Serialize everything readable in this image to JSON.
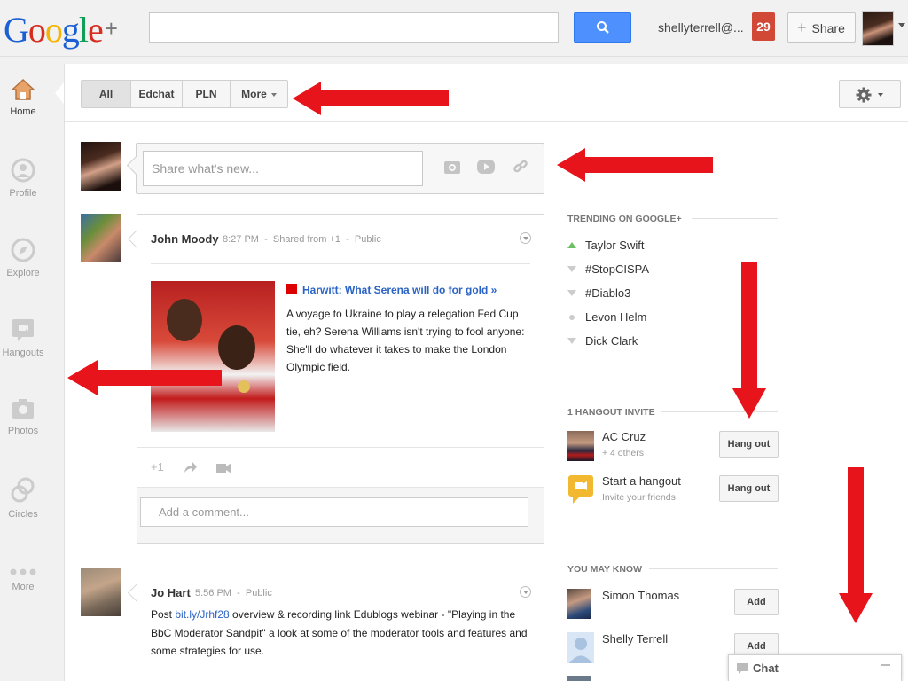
{
  "header": {
    "logo": {
      "g1": "G",
      "g2": "o",
      "g3": "o",
      "g4": "g",
      "g5": "l",
      "g6": "e",
      "plus": "+"
    },
    "search": {
      "value": "",
      "button_icon": "search-icon"
    },
    "user_email": "shellyterrell@...",
    "notification_count": "29",
    "share_label": "Share"
  },
  "rail": {
    "items": [
      {
        "label": "Home",
        "icon": "home-icon"
      },
      {
        "label": "Profile",
        "icon": "profile-icon"
      },
      {
        "label": "Explore",
        "icon": "compass-icon"
      },
      {
        "label": "Hangouts",
        "icon": "hangout-icon"
      },
      {
        "label": "Photos",
        "icon": "camera-icon"
      },
      {
        "label": "Circles",
        "icon": "circles-icon"
      },
      {
        "label": "More",
        "icon": "more-dots-icon"
      }
    ]
  },
  "stream": {
    "tabs": [
      "All",
      "Edchat",
      "PLN",
      "More"
    ],
    "selected_tab": "All"
  },
  "sharebox": {
    "placeholder": "Share what's new..."
  },
  "posts": [
    {
      "author": "John Moody",
      "time": "8:27 PM",
      "meta": "Shared from +1",
      "visibility": "Public",
      "link_title": "Harwitt: What Serena will do for gold »",
      "link_desc": "A voyage to Ukraine to play a relegation Fed Cup tie, eh? Serena Williams isn't trying to fool anyone: She'll do whatever it takes to make the London Olympic field.",
      "plus_one": "+1",
      "comment_placeholder": "Add a comment..."
    },
    {
      "author": "Jo Hart",
      "time": "5:56 PM",
      "visibility": "Public",
      "text_before": "Post ",
      "link": "bit.ly/Jrhf28",
      "text_after": " overview & recording link Edublogs webinar - \"Playing in the BbC Moderator Sandpit\" a look at some of the moderator tools and features and some strategies for use."
    }
  ],
  "trending": {
    "heading": "Trending on Google+",
    "items": [
      {
        "label": "Taylor Swift",
        "trend": "up"
      },
      {
        "label": "#StopCISPA",
        "trend": "down"
      },
      {
        "label": "#Diablo3",
        "trend": "down"
      },
      {
        "label": "Levon Helm",
        "trend": "same"
      },
      {
        "label": "Dick Clark",
        "trend": "down"
      }
    ]
  },
  "hangouts": {
    "heading": "1 Hangout invite",
    "items": [
      {
        "name": "AC Cruz",
        "sub": "+ 4 others",
        "button": "Hang out"
      },
      {
        "name": "Start a hangout",
        "sub": "Invite your friends",
        "button": "Hang out"
      }
    ]
  },
  "you_may_know": {
    "heading": "You may know",
    "items": [
      {
        "name": "Simon Thomas",
        "button": "Add"
      },
      {
        "name": "Shelly Terrell",
        "button": "Add"
      }
    ]
  },
  "chat": {
    "label": "Chat"
  },
  "colors": {
    "accent_blue": "#4d90fe",
    "notification_red": "#d14836",
    "link_blue": "#2a63c5",
    "annotation_arrow_red": "#e8141b"
  }
}
